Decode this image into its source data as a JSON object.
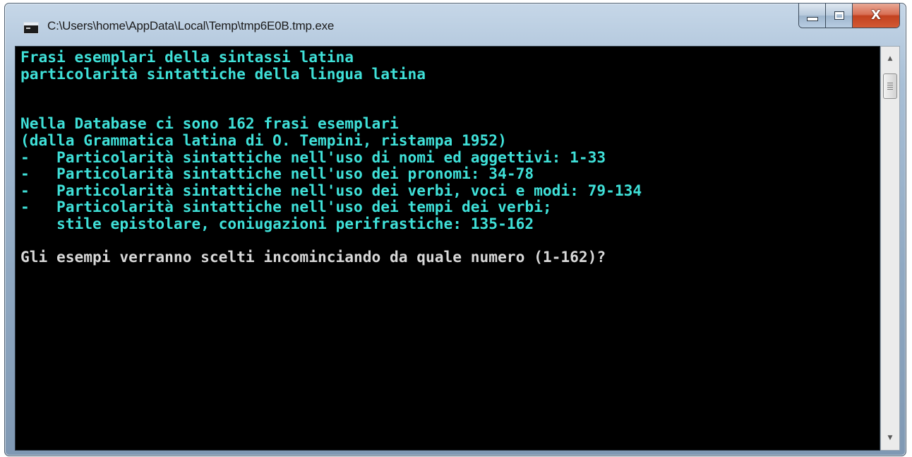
{
  "window": {
    "title": "C:\\Users\\home\\AppData\\Local\\Temp\\tmp6E0B.tmp.exe",
    "icon": "console-app-icon",
    "buttons": {
      "minimize": "minimize-icon",
      "maximize": "maximize-icon",
      "close": "close-icon"
    }
  },
  "console": {
    "lines": [
      "Frasi esemplari della sintassi latina",
      "particolarità sintattiche della lingua latina",
      "",
      "",
      "Nella Database ci sono 162 frasi esemplari",
      "(dalla Grammatica latina di O. Tempini, ristampa 1952)",
      "-   Particolarità sintattiche nell'uso di nomi ed aggettivi: 1-33",
      "-   Particolarità sintattiche nell'uso dei pronomi: 34-78",
      "-   Particolarità sintattiche nell'uso dei verbi, voci e modi: 79-134",
      "-   Particolarità sintattiche nell'uso dei tempi dei verbi;",
      "    stile epistolare, coniugazioni perifrastiche: 135-162",
      ""
    ],
    "prompt": "Gli esempi verranno scelti incominciando da quale numero (1-162)?",
    "text_color": "#3fe0d8",
    "prompt_color": "#d8d8d8",
    "background": "#000000"
  },
  "scrollbar": {
    "up_icon": "scroll-up-arrow-icon",
    "down_icon": "scroll-down-arrow-icon"
  }
}
